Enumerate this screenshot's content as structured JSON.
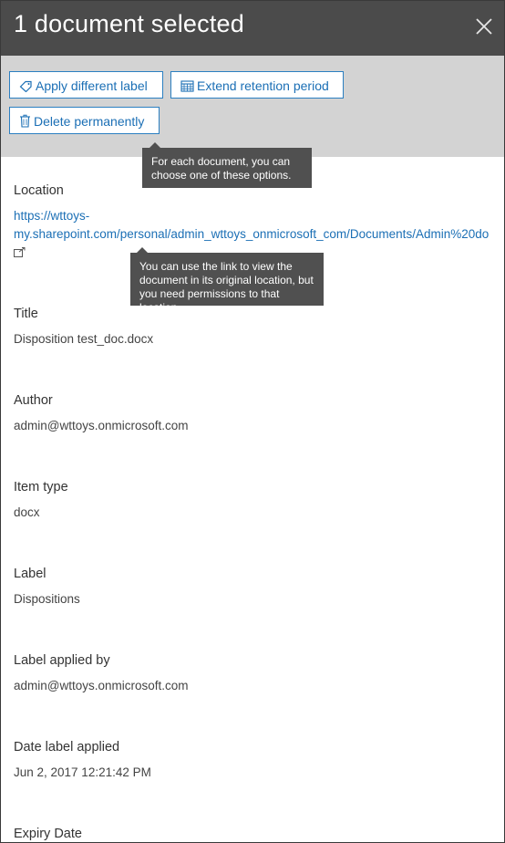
{
  "header": {
    "title": "1 document selected",
    "close_icon": "close-icon"
  },
  "toolbar": {
    "apply_label": "Apply different label",
    "extend_label": "Extend retention period",
    "delete_label": "Delete permanently"
  },
  "tooltips": {
    "options_line1": "For each document, you can",
    "options_line2": "choose one of these options.",
    "link_line1": "You can use the link to view the",
    "link_line2": "document in its original location, but",
    "link_line3": "you need permissions to that location."
  },
  "details": {
    "location": {
      "label": "Location",
      "url_line1": "https://wttoys-",
      "url_line2": "my.sharepoint.com/personal/admin_wttoys_onmicrosoft_com/Documents/Admin%20do"
    },
    "title": {
      "label": "Title",
      "value": "Disposition test_doc.docx"
    },
    "author": {
      "label": "Author",
      "value": "admin@wttoys.onmicrosoft.com"
    },
    "item_type": {
      "label": "Item type",
      "value": "docx"
    },
    "label": {
      "label": "Label",
      "value": "Dispositions"
    },
    "label_applied_by": {
      "label": "Label applied by",
      "value": "admin@wttoys.onmicrosoft.com"
    },
    "date_label_applied": {
      "label": "Date label applied",
      "value": "Jun 2, 2017 12:21:42 PM"
    },
    "expiry_date": {
      "label": "Expiry Date"
    }
  },
  "colors": {
    "header_bg": "#4b4b4b",
    "toolbar_bg": "#d3d3d3",
    "accent": "#1b6fb5",
    "tooltip_bg": "#505050"
  }
}
